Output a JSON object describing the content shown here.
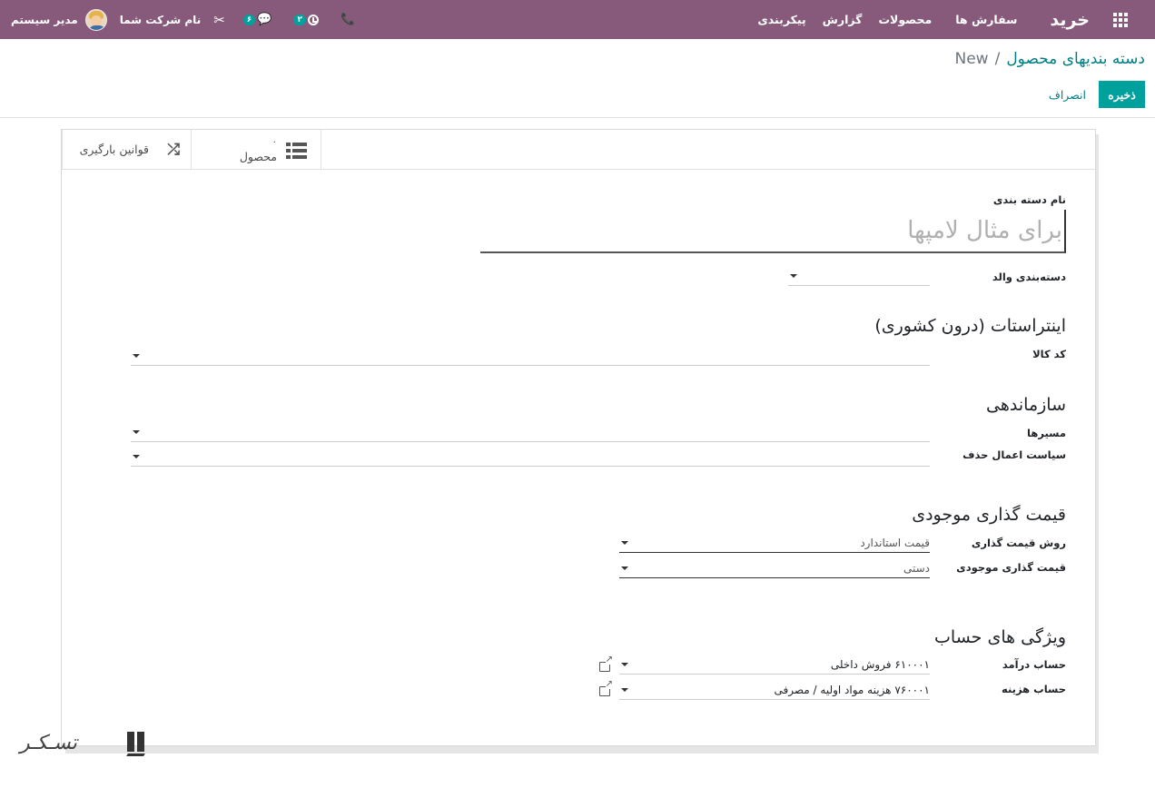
{
  "navbar": {
    "app_title": "خرید",
    "menu": [
      "سفارش ها",
      "محصولات",
      "گزارش",
      "پیکربندی"
    ],
    "user_name": "مدیر سیستم",
    "company_name": "نام شرکت شما",
    "chat_count": "۶",
    "activity_count": "۲"
  },
  "breadcrumb": {
    "parent": "دسته بندیهای محصول",
    "separator": "/",
    "current": "New"
  },
  "actions": {
    "save_label": "ذخیره",
    "discard_label": "انصراف"
  },
  "smart_buttons": {
    "products_value": "۰",
    "products_label": "محصول",
    "putaway_label": "قوانین بارگیری"
  },
  "form": {
    "name_label": "نام دسته بندی",
    "name_placeholder": "برای مثال لامپها",
    "parent_label": "دسته‌بندی والد",
    "intrastat_title": "اینتراستات (درون کشوری)",
    "commodity_label": "کد کالا",
    "logistics_title": "سازماندهی",
    "routes_label": "مسیرها",
    "removal_label": "سیاست اعمال حذف",
    "valuation_title": "قیمت گذاری موجودی",
    "costing_label": "روش قیمت گذاری",
    "costing_value": "قیمت استاندارد",
    "valuation_label": "قیمت گذاری موجودی",
    "valuation_value": "دستی",
    "account_title": "ویژگی های حساب",
    "income_label": "حساب درآمد",
    "income_value": "۶۱۰۰۰۱ فروش داخلی",
    "expense_label": "حساب هزینه",
    "expense_value": "۷۶۰۰۰۱ هزینه مواد اولیه / مصرفی"
  },
  "watermark": {
    "text": "تسـکـر"
  }
}
